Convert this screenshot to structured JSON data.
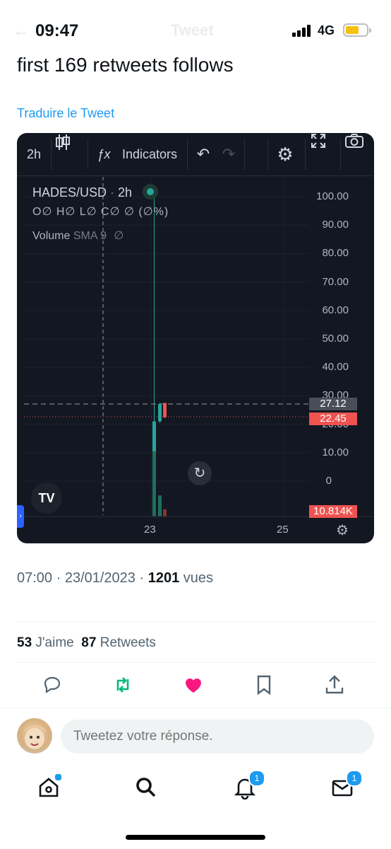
{
  "status_bar": {
    "time": "09:47",
    "network": "4G",
    "screen_title": "Tweet"
  },
  "tweet": {
    "text": "first 169 retweets follows",
    "translate_link": "Traduire le Tweet",
    "timestamp": "07:00 · 23/01/2023 · ",
    "views_count": "1201",
    "views_label": " vues",
    "likes_count": "53",
    "likes_label": " J'aime  ",
    "retweets_count": "87",
    "retweets_label": " Retweets"
  },
  "chart": {
    "toolbar": {
      "interval": "2h",
      "fx_label": "ƒx",
      "indicators": "Indicators"
    },
    "legend": {
      "pair": "HADES/USD",
      "sep": " · ",
      "interval": "2h",
      "ohlc": "O∅ H∅ L∅ C∅ ∅ (∅%)",
      "volume": "Volume",
      "sma": "SMA 9",
      "sma_val": "∅"
    },
    "y_labels": [
      "100.00",
      "90.00",
      "80.00",
      "70.00",
      "60.00",
      "50.00",
      "40.00",
      "30.00",
      "20.00",
      "10.00",
      "0"
    ],
    "crosshair_price": "27.12",
    "last_price": "22.45",
    "volume_tag": "10.814K",
    "x_labels": [
      "23",
      "25"
    ],
    "logo": "TV",
    "colors": {
      "up": "#26a69a",
      "down": "#ef5350",
      "bg": "#131722"
    },
    "chart_data": {
      "type": "candlestick",
      "title": "HADES/USD · 2h",
      "x": [
        "23",
        "23",
        "23"
      ],
      "candles": [
        {
          "open": 0,
          "high": 100,
          "low": 0,
          "close": 21,
          "direction": "up"
        },
        {
          "open": 21,
          "high": 27.5,
          "low": 20.5,
          "close": 27.12,
          "direction": "up"
        },
        {
          "open": 27.5,
          "high": 27.5,
          "low": 22,
          "close": 22.45,
          "direction": "down"
        }
      ],
      "volume_series": [
        {
          "value": 10.814,
          "unit": "K",
          "direction": "up"
        },
        {
          "value": 3.5,
          "unit": "K",
          "direction": "up"
        },
        {
          "value": 1.2,
          "unit": "K",
          "direction": "down"
        }
      ],
      "ylim": [
        0,
        100
      ],
      "yticks": [
        0,
        10,
        20,
        30,
        40,
        50,
        60,
        70,
        80,
        90,
        100
      ],
      "grid": true
    }
  },
  "reply": {
    "placeholder": "Tweetez votre réponse."
  },
  "nav": {
    "notifications_badge": "1",
    "messages_badge": "1"
  }
}
